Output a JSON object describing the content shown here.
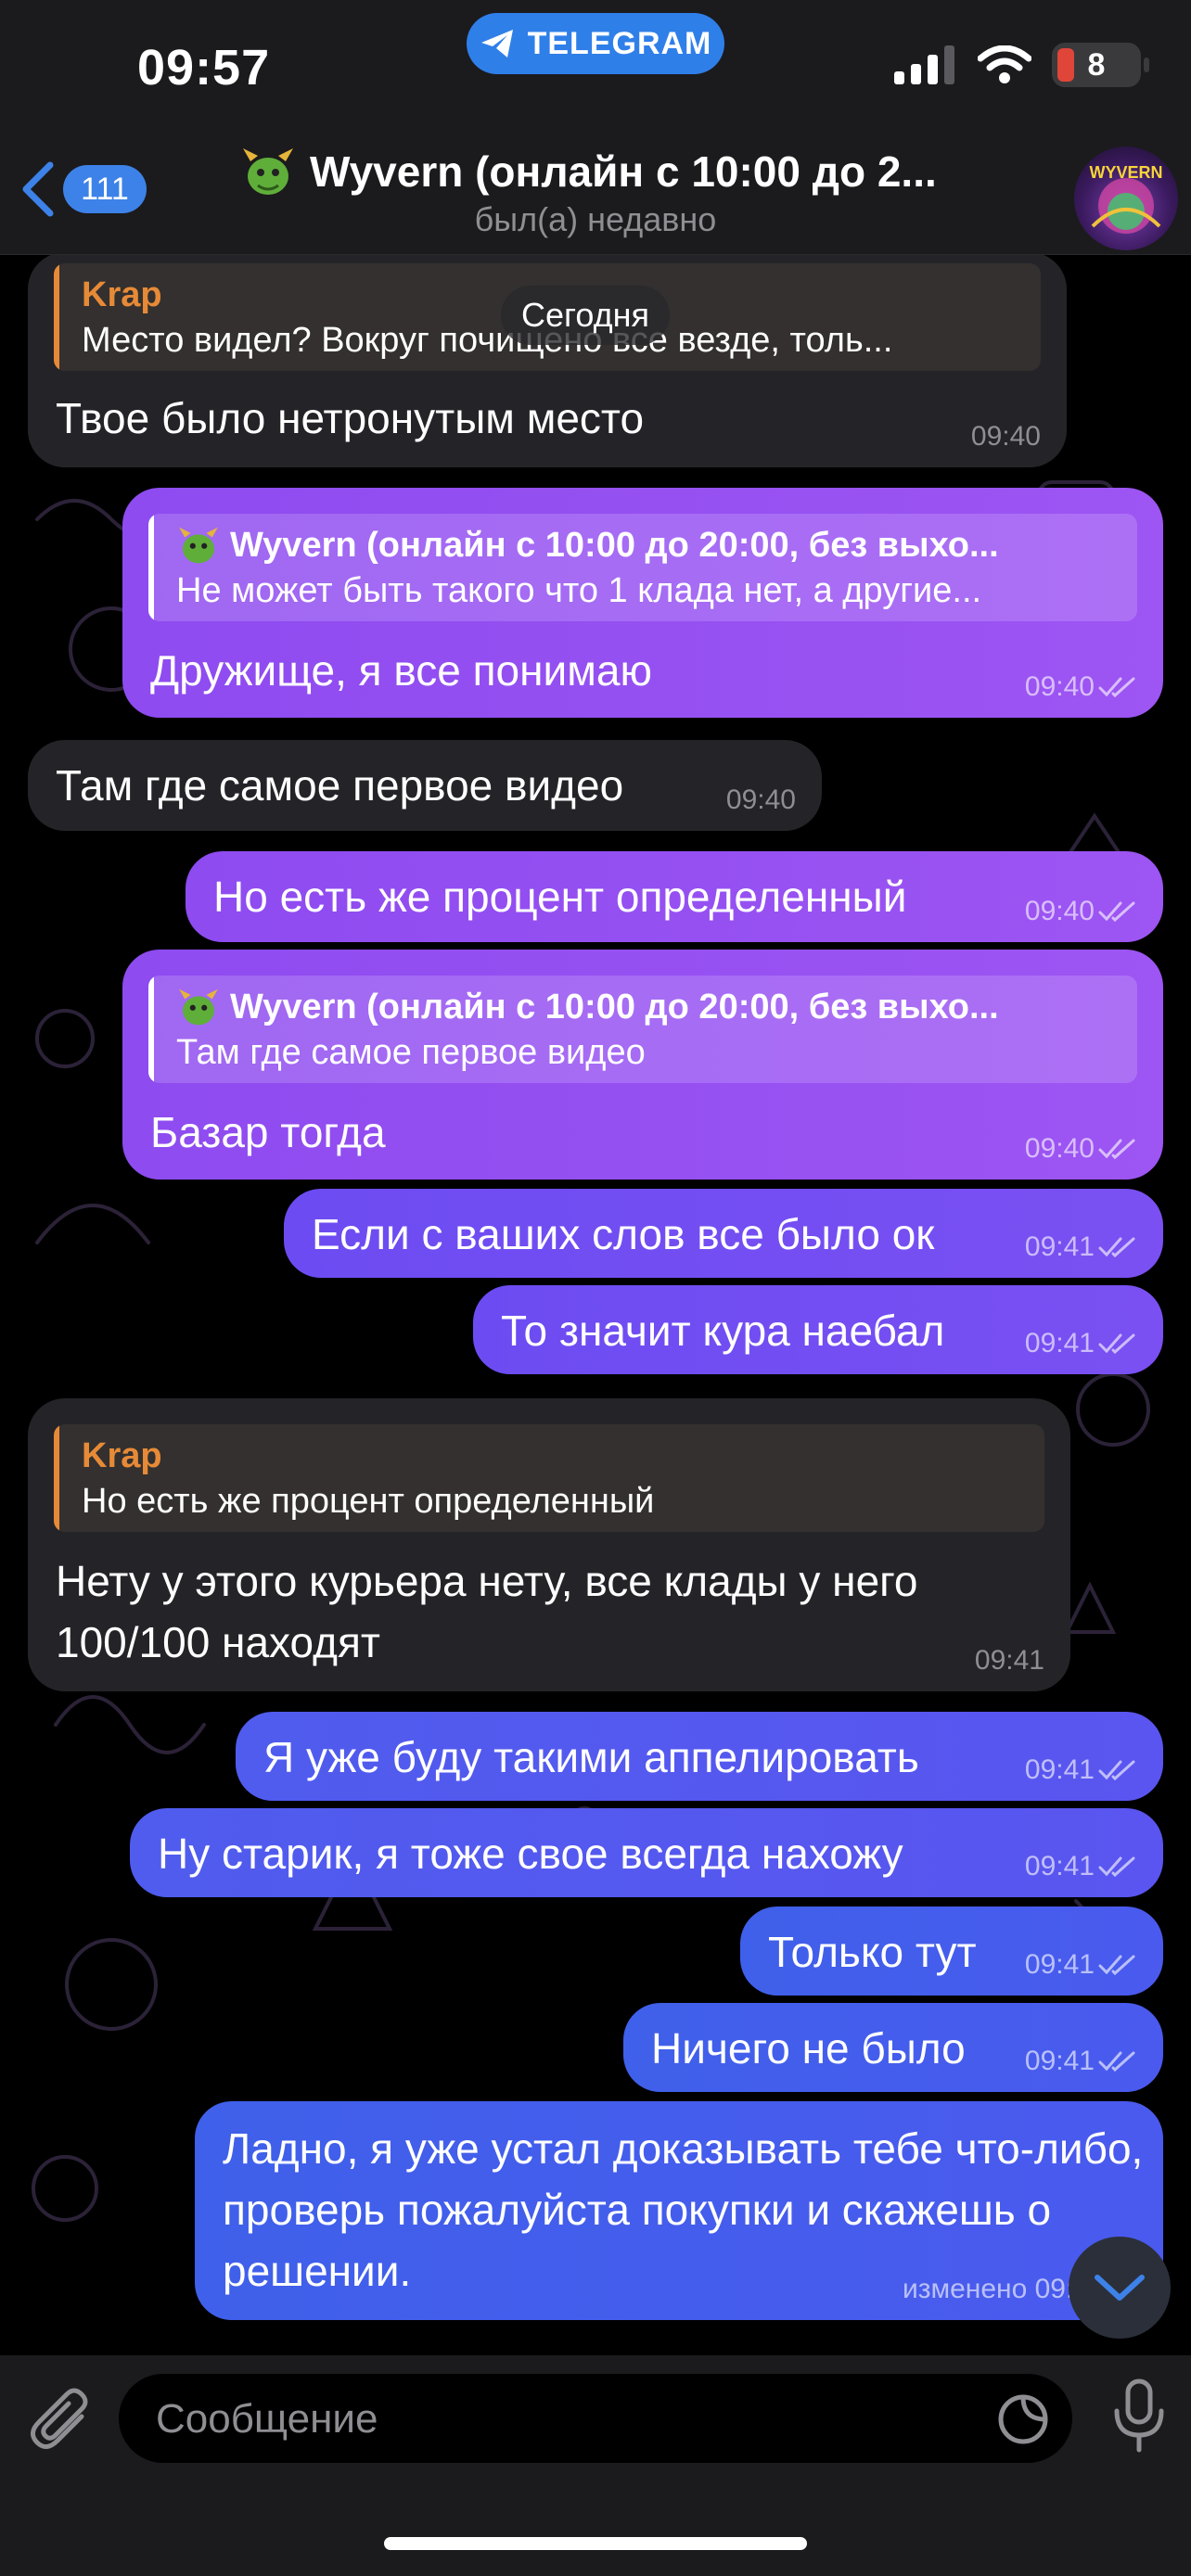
{
  "status_bar": {
    "time": "09:57",
    "app_pill": "TELEGRAM",
    "battery": "8"
  },
  "header": {
    "back_count": "111",
    "title": "Wyvern (онлайн с 10:00 до 2...",
    "status": "был(а) недавно",
    "avatar_text": "WYVERN"
  },
  "date_pill": "Сегодня",
  "messages": [
    {
      "dir": "in",
      "reply_name": "Krap",
      "reply_text": "Место видел? Вокруг почищено все везде, толь...",
      "text": "Твое было нетронутым место",
      "time": "09:40"
    },
    {
      "dir": "out",
      "reply_name": "Wyvern (онлайн с 10:00 до 20:00, без выхо...",
      "reply_text": "Не может быть такого что 1 клада нет, а другие...",
      "text": "Дружище, я все понимаю",
      "time": "09:40"
    },
    {
      "dir": "in",
      "text": "Там где самое первое видео",
      "time": "09:40"
    },
    {
      "dir": "out",
      "text": "Но есть же процент определенный",
      "time": "09:40"
    },
    {
      "dir": "out",
      "reply_name": "Wyvern (онлайн с 10:00 до 20:00, без выхо...",
      "reply_text": "Там где самое первое видео",
      "text": "Базар тогда",
      "time": "09:40"
    },
    {
      "dir": "out",
      "text": "Если с ваших слов все было ок",
      "time": "09:41"
    },
    {
      "dir": "out",
      "text": "То значит кура наебал",
      "time": "09:41"
    },
    {
      "dir": "in",
      "reply_name": "Krap",
      "reply_text": "Но есть же процент определенный",
      "text": "Нету у этого курьера нету, все клады у него 100/100 находят",
      "time": "09:41"
    },
    {
      "dir": "out",
      "text": "Я уже буду такими аппелировать",
      "time": "09:41"
    },
    {
      "dir": "out",
      "text": "Ну старик, я тоже свое всегда нахожу",
      "time": "09:41"
    },
    {
      "dir": "out",
      "text": "Только тут",
      "time": "09:41"
    },
    {
      "dir": "out",
      "text": "Ничего не было",
      "time": "09:41"
    },
    {
      "dir": "out",
      "text": "Ладно, я уже устал доказывать тебе что-либо, проверь пожалуйста покупки и скажешь о решении.",
      "time": "изменено 09:4"
    }
  ],
  "input": {
    "placeholder": "Сообщение"
  },
  "icons": {
    "back": "chevron-left-icon",
    "attach": "paperclip-icon",
    "sticker": "sticker-icon",
    "mic": "microphone-icon",
    "read": "double-check-icon",
    "scroll": "chevron-down-icon"
  },
  "colors": {
    "accent": "#3d82e8",
    "reply_in": "#e78a37",
    "bubble_in": "#242428",
    "bubble_out_top": "#9d55f3",
    "bubble_out_bottom": "#3f60ea"
  }
}
